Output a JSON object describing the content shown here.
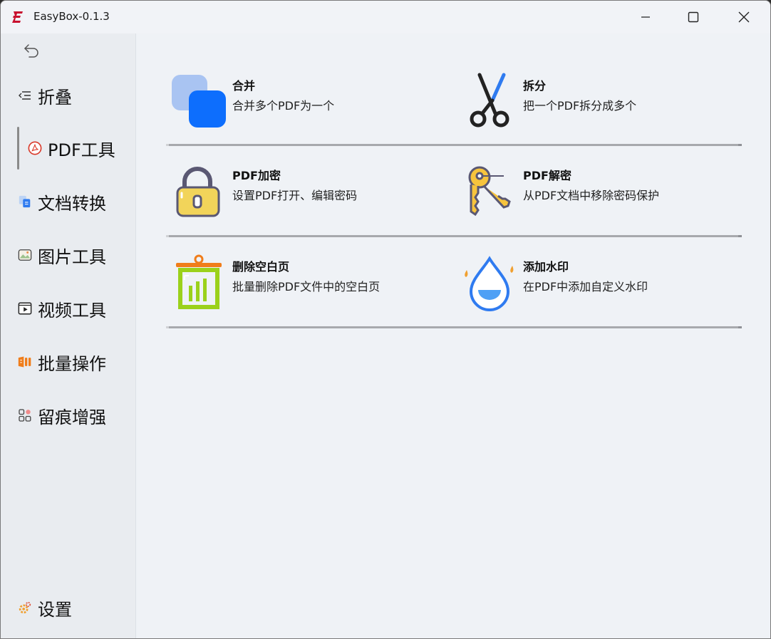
{
  "window": {
    "title": "EasyBox-0.1.3"
  },
  "sidebar": {
    "items": [
      {
        "label": "折叠",
        "icon": "collapse-icon"
      },
      {
        "label": "PDF工具",
        "icon": "pdf-icon",
        "active": true
      },
      {
        "label": "文档转换",
        "icon": "doc-convert-icon"
      },
      {
        "label": "图片工具",
        "icon": "image-icon"
      },
      {
        "label": "视频工具",
        "icon": "video-icon"
      },
      {
        "label": "批量操作",
        "icon": "batch-icon"
      },
      {
        "label": "留痕增强",
        "icon": "trace-icon"
      }
    ],
    "settings": {
      "label": "设置",
      "icon": "settings-icon"
    }
  },
  "tools": [
    {
      "title": "合并",
      "desc": "合并多个PDF为一个",
      "icon": "merge-icon"
    },
    {
      "title": "拆分",
      "desc": "把一个PDF拆分成多个",
      "icon": "scissors-icon"
    },
    {
      "title": "PDF加密",
      "desc": "设置PDF打开、编辑密码",
      "icon": "lock-icon"
    },
    {
      "title": "PDF解密",
      "desc": "从PDF文档中移除密码保护",
      "icon": "key-icon"
    },
    {
      "title": "删除空白页",
      "desc": "批量删除PDF文件中的空白页",
      "icon": "trash-icon"
    },
    {
      "title": "添加水印",
      "desc": "在PDF中添加自定义水印",
      "icon": "watermark-icon"
    }
  ],
  "colors": {
    "accent": "#0d6efd",
    "sidebar_bg": "#e9ecf0",
    "content_bg": "#eff2f6"
  }
}
